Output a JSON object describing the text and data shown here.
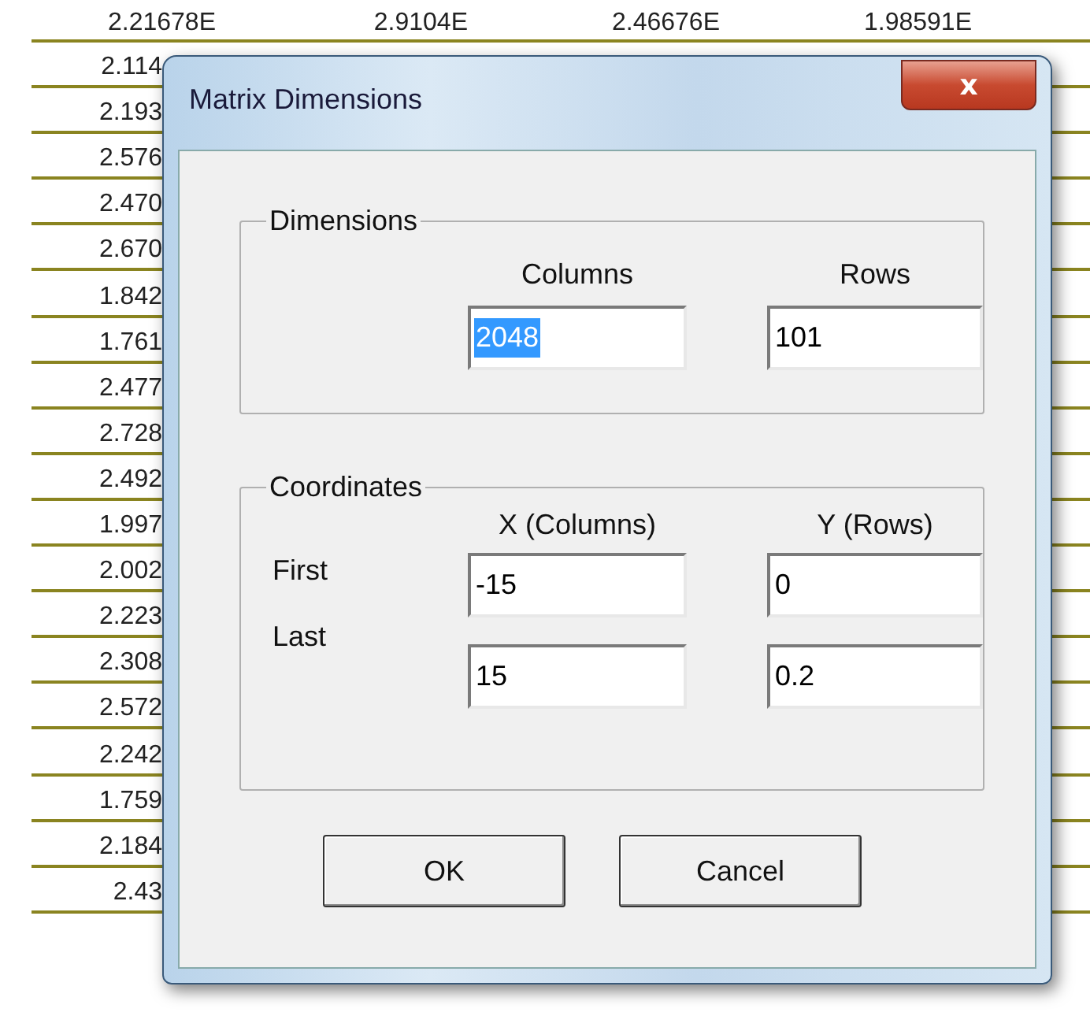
{
  "sheet": {
    "header_row": [
      "2.21678E",
      "2.9104E",
      "2.46676E",
      "1.98591E"
    ],
    "column_1": [
      "2.114",
      "2.193",
      "2.576",
      "2.470",
      "2.670",
      "1.842",
      "1.761",
      "2.477",
      "2.728",
      "2.492",
      "1.997",
      "2.002",
      "2.223",
      "2.308",
      "2.572",
      "2.242",
      "1.759",
      "2.184",
      "2.43"
    ]
  },
  "dialog": {
    "title": "Matrix Dimensions",
    "close": "x",
    "dimensions": {
      "legend": "Dimensions",
      "column_headers": [
        "Columns",
        "Rows"
      ],
      "rows": [
        {
          "label": "",
          "fields": [
            {
              "value": "2048",
              "selected": true
            },
            {
              "value": "101",
              "selected": false
            }
          ]
        }
      ]
    },
    "coordinates": {
      "legend": "Coordinates",
      "column_headers": [
        "X (Columns)",
        "Y (Rows)"
      ],
      "rows": [
        {
          "label": "First",
          "fields": [
            {
              "value": "-15",
              "selected": false
            },
            {
              "value": "0",
              "selected": false
            }
          ]
        },
        {
          "label": "Last",
          "fields": [
            {
              "value": "15",
              "selected": false
            },
            {
              "value": "0.2",
              "selected": false
            }
          ]
        }
      ]
    },
    "buttons": [
      "OK",
      "Cancel"
    ]
  }
}
